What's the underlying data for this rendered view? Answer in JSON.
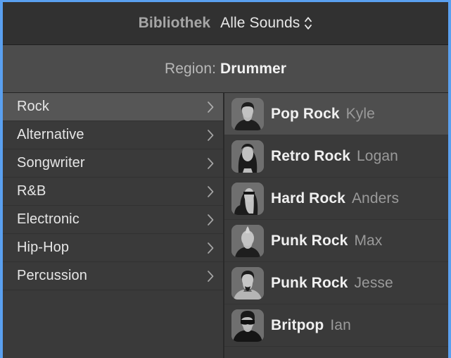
{
  "header": {
    "library_label": "Bibliothek",
    "sound_filter_value": "Alle Sounds",
    "sound_filter_icon": "up-down-chevron-icon"
  },
  "region": {
    "prefix": "Region:",
    "value": "Drummer"
  },
  "sidebar": {
    "items": [
      {
        "label": "Rock",
        "selected": true,
        "chevron": "chevron-right-icon"
      },
      {
        "label": "Alternative",
        "selected": false,
        "chevron": "chevron-right-icon"
      },
      {
        "label": "Songwriter",
        "selected": false,
        "chevron": "chevron-right-icon"
      },
      {
        "label": "R&B",
        "selected": false,
        "chevron": "chevron-right-icon"
      },
      {
        "label": "Electronic",
        "selected": false,
        "chevron": "chevron-right-icon"
      },
      {
        "label": "Hip-Hop",
        "selected": false,
        "chevron": "chevron-right-icon"
      },
      {
        "label": "Percussion",
        "selected": false,
        "chevron": "chevron-right-icon"
      }
    ]
  },
  "soundlist": {
    "items": [
      {
        "name": "Pop Rock",
        "artist": "Kyle",
        "avatar": "avatar-short-dark-hair",
        "selected": true
      },
      {
        "name": "Retro Rock",
        "artist": "Logan",
        "avatar": "avatar-long-hair-beard",
        "selected": false
      },
      {
        "name": "Hard Rock",
        "artist": "Anders",
        "avatar": "avatar-long-hair-headband",
        "selected": false
      },
      {
        "name": "Punk Rock",
        "artist": "Max",
        "avatar": "avatar-mohawk",
        "selected": false
      },
      {
        "name": "Punk Rock",
        "artist": "Jesse",
        "avatar": "avatar-goatee",
        "selected": false
      },
      {
        "name": "Britpop",
        "artist": "Ian",
        "avatar": "avatar-sunglasses",
        "selected": false
      }
    ]
  },
  "colors": {
    "focus_border": "#5aa0f0",
    "header_bg": "#313131",
    "region_bg": "#4c4c4c",
    "panel_bg": "#3a3a3a",
    "selected_row": "#565656",
    "selected_sound_row": "#4e4e4e",
    "text_primary": "#f0f0f0",
    "text_secondary": "#9a9a9a"
  }
}
